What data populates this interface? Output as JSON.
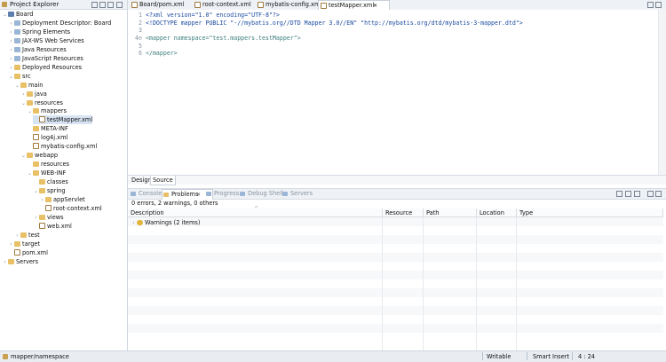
{
  "explorer": {
    "title": "Project Explorer",
    "items": [
      {
        "label": "Board",
        "depth": 0,
        "icon": "project-icon",
        "expanded": true
      },
      {
        "label": "Deployment Descriptor: Board",
        "depth": 1,
        "icon": "deployment-icon",
        "expanded": false
      },
      {
        "label": "Spring Elements",
        "depth": 1,
        "icon": "spring-icon",
        "expanded": false
      },
      {
        "label": "JAX-WS Web Services",
        "depth": 1,
        "icon": "webservice-icon",
        "expanded": false
      },
      {
        "label": "Java Resources",
        "depth": 1,
        "icon": "java-resources-icon",
        "expanded": false
      },
      {
        "label": "JavaScript Resources",
        "depth": 1,
        "icon": "js-resources-icon",
        "expanded": false
      },
      {
        "label": "Deployed Resources",
        "depth": 1,
        "icon": "folder-icon",
        "expanded": false
      },
      {
        "label": "src",
        "depth": 1,
        "icon": "folder-icon",
        "expanded": true
      },
      {
        "label": "main",
        "depth": 2,
        "icon": "folder-icon",
        "expanded": true
      },
      {
        "label": "java",
        "depth": 3,
        "icon": "folder-icon",
        "expanded": false
      },
      {
        "label": "resources",
        "depth": 3,
        "icon": "folder-icon",
        "expanded": true
      },
      {
        "label": "mappers",
        "depth": 4,
        "icon": "folder-icon",
        "expanded": true
      },
      {
        "label": "testMapper.xml",
        "depth": 5,
        "icon": "xml-file-icon",
        "selected": true
      },
      {
        "label": "META-INF",
        "depth": 4,
        "icon": "folder-icon"
      },
      {
        "label": "log4j.xml",
        "depth": 4,
        "icon": "xml-file-icon"
      },
      {
        "label": "mybatis-config.xml",
        "depth": 4,
        "icon": "xml-file-icon"
      },
      {
        "label": "webapp",
        "depth": 3,
        "icon": "folder-icon",
        "expanded": true
      },
      {
        "label": "resources",
        "depth": 4,
        "icon": "folder-icon"
      },
      {
        "label": "WEB-INF",
        "depth": 4,
        "icon": "folder-icon",
        "expanded": true
      },
      {
        "label": "classes",
        "depth": 5,
        "icon": "folder-icon"
      },
      {
        "label": "spring",
        "depth": 5,
        "icon": "folder-icon",
        "expanded": true
      },
      {
        "label": "appServlet",
        "depth": 6,
        "icon": "folder-icon",
        "expanded": false
      },
      {
        "label": "root-context.xml",
        "depth": 6,
        "icon": "xml-file-icon"
      },
      {
        "label": "views",
        "depth": 5,
        "icon": "folder-icon",
        "expanded": false
      },
      {
        "label": "web.xml",
        "depth": 5,
        "icon": "xml-file-icon"
      },
      {
        "label": "test",
        "depth": 2,
        "icon": "folder-icon",
        "expanded": false
      },
      {
        "label": "target",
        "depth": 1,
        "icon": "folder-icon",
        "expanded": false
      },
      {
        "label": "pom.xml",
        "depth": 1,
        "icon": "xml-file-icon"
      },
      {
        "label": "Servers",
        "depth": 0,
        "icon": "folder-icon",
        "expanded": false
      }
    ]
  },
  "editor_tabs": [
    {
      "label": "Board/pom.xml",
      "active": false
    },
    {
      "label": "root-context.xml",
      "active": false
    },
    {
      "label": "mybatis-config.xml",
      "active": false
    },
    {
      "label": "testMapper.xml",
      "active": true
    }
  ],
  "editor": {
    "lines": [
      {
        "num": "1",
        "text": "<?xml version=\"1.0\" encoding=\"UTF-8\"?>"
      },
      {
        "num": "2",
        "text": "<!DOCTYPE mapper PUBLIC \"-//mybatis.org//DTD Mapper 3.0//EN\" \"http://mybatis.org/dtd/mybatis-3-mapper.dtd\">"
      },
      {
        "num": "3",
        "text": ""
      },
      {
        "num": "4⊖",
        "text": "<mapper namespace=\"test.mappers.testMapper\">"
      },
      {
        "num": "5",
        "text": ""
      },
      {
        "num": "6",
        "text": "</mapper>"
      }
    ]
  },
  "design_tabs": [
    "Design",
    "Source"
  ],
  "bottom_tabs": [
    {
      "label": "Console",
      "active": false
    },
    {
      "label": "Problems",
      "active": true
    },
    {
      "label": "Progress",
      "active": false
    },
    {
      "label": "Debug Shell",
      "active": false
    },
    {
      "label": "Servers",
      "active": false
    }
  ],
  "problems": {
    "summary": "0 errors, 2 warnings, 0 others",
    "columns": [
      "Description",
      "Resource",
      "Path",
      "Location",
      "Type"
    ],
    "rows": [
      {
        "description": "Warnings (2 items)"
      }
    ]
  },
  "status": {
    "path": "mapper/namespace",
    "mode": "Writable",
    "insert": "Smart Insert",
    "position": "4 : 24"
  }
}
